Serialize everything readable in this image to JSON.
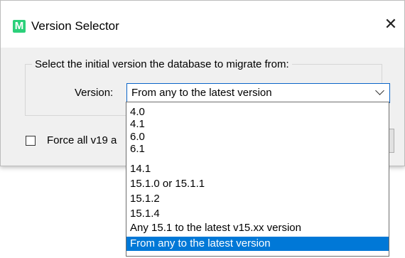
{
  "window": {
    "title": "Version Selector",
    "logo_letter": "M",
    "close_glyph": "✕"
  },
  "group": {
    "legend": "Select the initial version the database to migrate from:"
  },
  "version": {
    "label": "Version:",
    "selected": "From any to the latest version",
    "options": [
      "4.0",
      "4.1",
      "6.0",
      "6.1",
      "14.1",
      "15.1.0 or 15.1.1",
      "15.1.2",
      "15.1.4",
      "Any 15.1 to the latest v15.xx version",
      "From any to the latest version"
    ],
    "selected_index": 9
  },
  "checkbox": {
    "label": "Force all v19 a",
    "checked": false
  },
  "colors": {
    "accent": "#0078d7",
    "logo": "#2bd07a"
  }
}
